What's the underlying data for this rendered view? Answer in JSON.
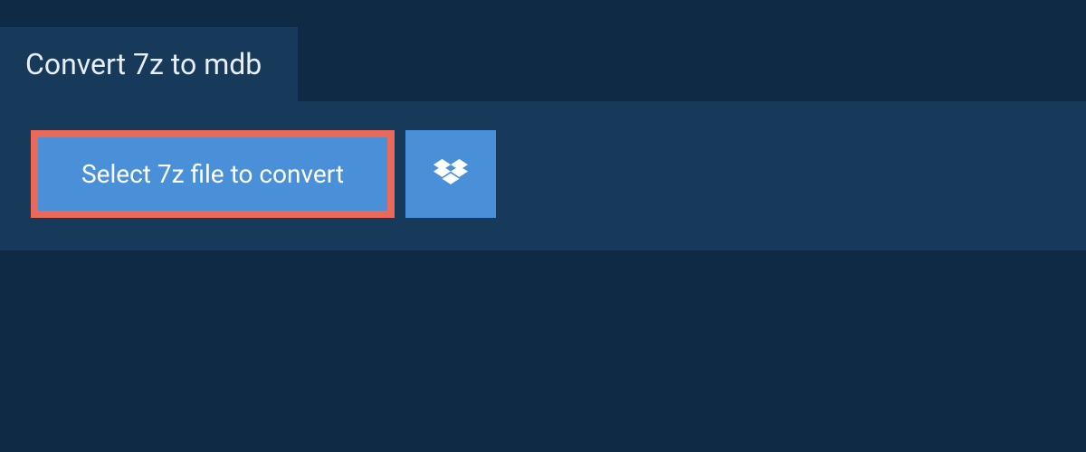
{
  "header": {
    "title": "Convert 7z to mdb"
  },
  "actions": {
    "select_label": "Select 7z file to convert",
    "dropbox_icon": "dropbox-icon"
  },
  "colors": {
    "bg_dark": "#0f2a44",
    "bg_panel": "#183a5a",
    "button_blue": "#4a90d9",
    "highlight_border": "#e96a5a",
    "text_light": "#ffffff"
  }
}
